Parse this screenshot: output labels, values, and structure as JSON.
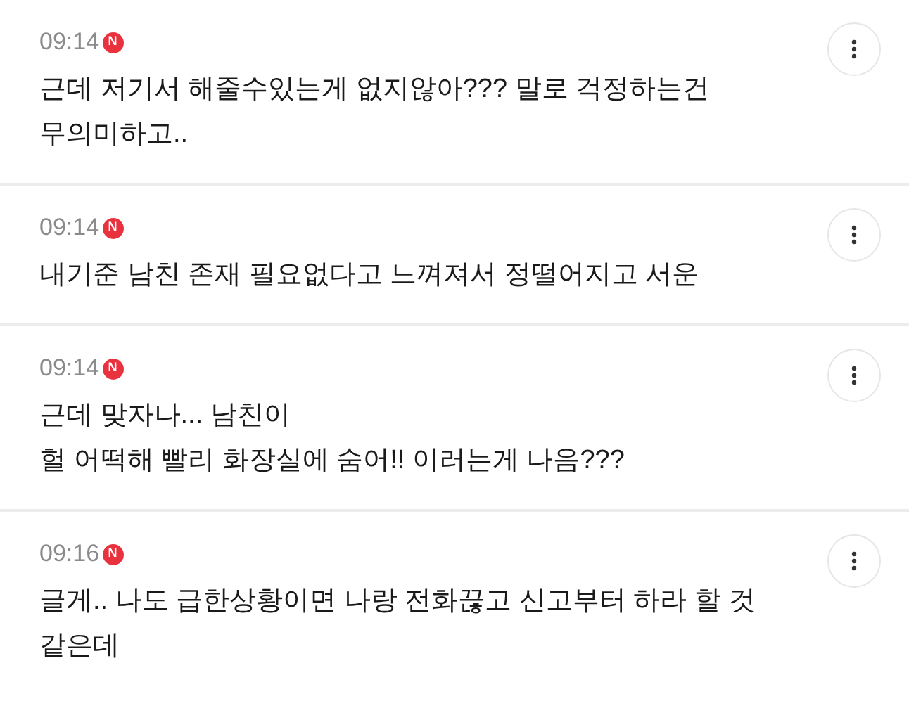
{
  "comments": [
    {
      "time": "09:14",
      "badge": "N",
      "lines": [
        "근데 저기서 해줄수있는게 없지않아??? 말로 걱정하는건",
        "무의미하고.."
      ]
    },
    {
      "time": "09:14",
      "badge": "N",
      "lines": [
        "내기준 남친 존재 필요없다고 느껴져서 정떨어지고 서운"
      ]
    },
    {
      "time": "09:14",
      "badge": "N",
      "lines": [
        "근데 맞자나... 남친이",
        "헐 어떡해 빨리 화장실에 숨어!! 이러는게 나음???"
      ]
    },
    {
      "time": "09:16",
      "badge": "N",
      "lines": [
        "글게.. 나도 급한상황이면 나랑 전화끊고 신고부터 하라 할 것",
        "같은데"
      ]
    }
  ]
}
